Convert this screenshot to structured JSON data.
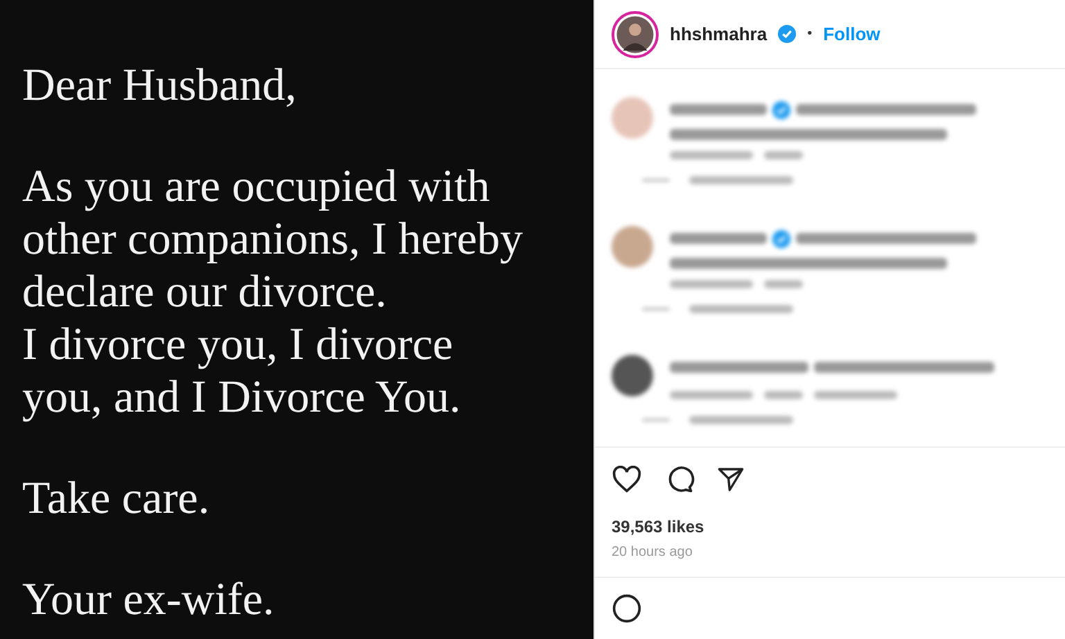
{
  "post_image": {
    "paragraphs": [
      [
        "Dear Husband,"
      ],
      [
        "As you are occupied with",
        "other companions, I hereby",
        "declare our divorce.",
        "I divorce you, I divorce",
        "you, and I Divorce You."
      ],
      [
        "Take care."
      ],
      [
        "Your ex-wife."
      ]
    ]
  },
  "header": {
    "username": "hhshmahra",
    "verified": true,
    "separator": "•",
    "follow": "Follow"
  },
  "comments": [
    {
      "kind": "long",
      "verified": true,
      "translation": false
    },
    {
      "kind": "long",
      "verified": true,
      "translation": false
    },
    {
      "kind": "short",
      "verified": false,
      "translation": true
    }
  ],
  "likes": "39,563 likes",
  "time": "20 hours ago"
}
